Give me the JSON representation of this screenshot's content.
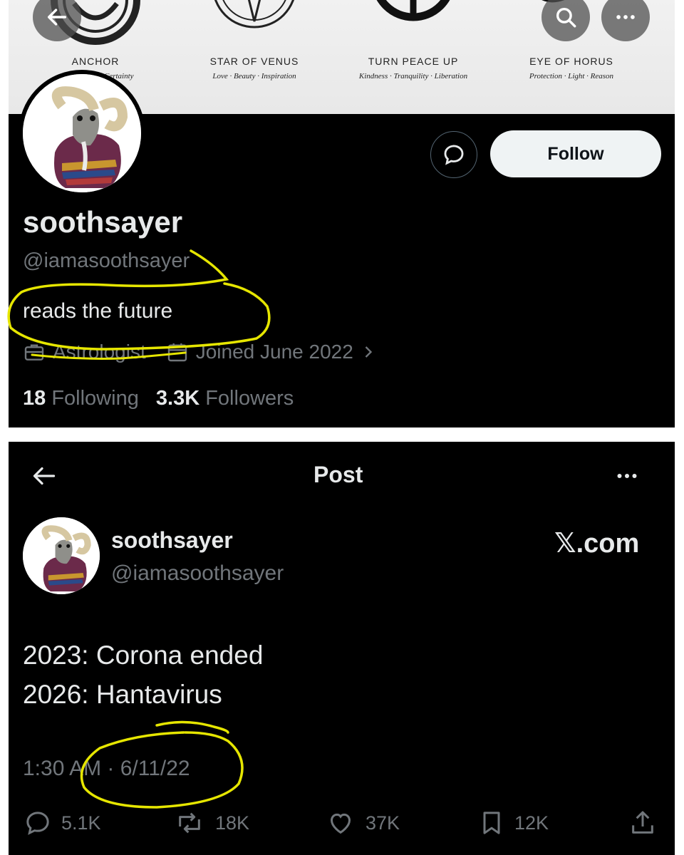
{
  "banner": {
    "symbols": [
      {
        "name": "ANCHOR",
        "subtitle": "· Certainty"
      },
      {
        "name": "STAR OF VENUS",
        "subtitle": "Love · Beauty · Inspiration"
      },
      {
        "name": "TURN PEACE UP",
        "subtitle": "Kindness · Tranquility · Liberation"
      },
      {
        "name": "EYE OF HORUS",
        "subtitle": "Protection · Light · Reason"
      }
    ]
  },
  "profile": {
    "display_name": "soothsayer",
    "handle": "@iamasoothsayer",
    "bio": "reads the future",
    "category": "Astrologist",
    "joined": "Joined June 2022",
    "following_count": "18",
    "following_label": "Following",
    "followers_count": "3.3K",
    "followers_label": "Followers",
    "follow_label": "Follow"
  },
  "post": {
    "header_title": "Post",
    "author_name": "soothsayer",
    "author_handle": "@iamasoothsayer",
    "watermark": "𝕏.com",
    "lines": [
      "2023: Corona ended",
      "2026: Hantavirus"
    ],
    "timestamp": "1:30 AM · 6/11/22",
    "replies": "5.1K",
    "reposts": "18K",
    "likes": "37K",
    "bookmarks": "12K"
  },
  "icons": {
    "back": "back-arrow-icon",
    "search": "search-icon",
    "more": "more-icon",
    "message": "message-icon",
    "briefcase": "briefcase-icon",
    "calendar": "calendar-icon",
    "reply": "reply-icon",
    "repost": "repost-icon",
    "like": "like-icon",
    "bookmark": "bookmark-icon",
    "share": "share-icon"
  },
  "colors": {
    "background": "#000000",
    "text_primary": "#e7e9ea",
    "text_secondary": "#71767b",
    "follow_button": "#eff3f4",
    "highlight_marker": "#e6e600"
  }
}
